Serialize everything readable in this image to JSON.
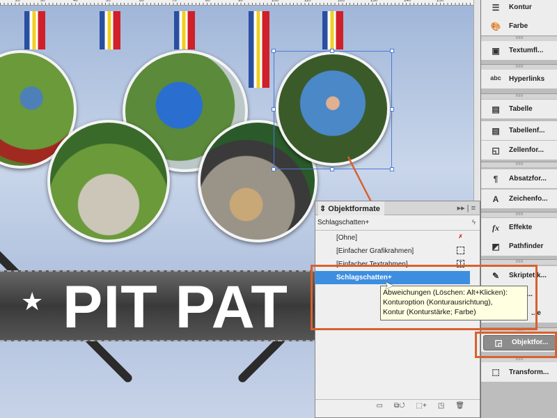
{
  "ruler": {
    "labels": [
      "20",
      "30",
      "40",
      "50",
      "60",
      "70",
      "80",
      "90",
      "100",
      "110",
      "120",
      "130",
      "140",
      "150"
    ]
  },
  "document": {
    "banner_title": "PIT PAT",
    "star": "★"
  },
  "panel": {
    "title": "Objektformate",
    "current_style": "Schlagschatten+",
    "styles": [
      {
        "label": "[Ohne]",
        "icon": "no-edit-icon"
      },
      {
        "label": "[Einfacher Grafikrahmen]",
        "icon": "graphic-frame-icon"
      },
      {
        "label": "[Einfacher Textrahmen]",
        "icon": "text-frame-icon"
      },
      {
        "label": "Schlagschatten+",
        "selected": true
      }
    ],
    "tooltip": [
      "Abweichungen (Löschen: Alt+Klicken):",
      "Konturoption (Konturausrichtung),",
      "Kontur (Konturstärke; Farbe)"
    ]
  },
  "dock": {
    "items": [
      "Kontur",
      "Farbe",
      "Textumfl...",
      "Hyperlinks",
      "Tabelle",
      "Tabellenf...",
      "Zellenfor...",
      "Absatzfor...",
      "Zeichenfo...",
      "Effekte",
      "Pathfinder",
      "Skriptetik...",
      "...usa...",
      "...e",
      "Objektfor...",
      "Transform..."
    ]
  },
  "colors": {
    "accent": "#3d8ee0",
    "highlight": "#d9602e",
    "tooltip": "#ffffe1"
  }
}
